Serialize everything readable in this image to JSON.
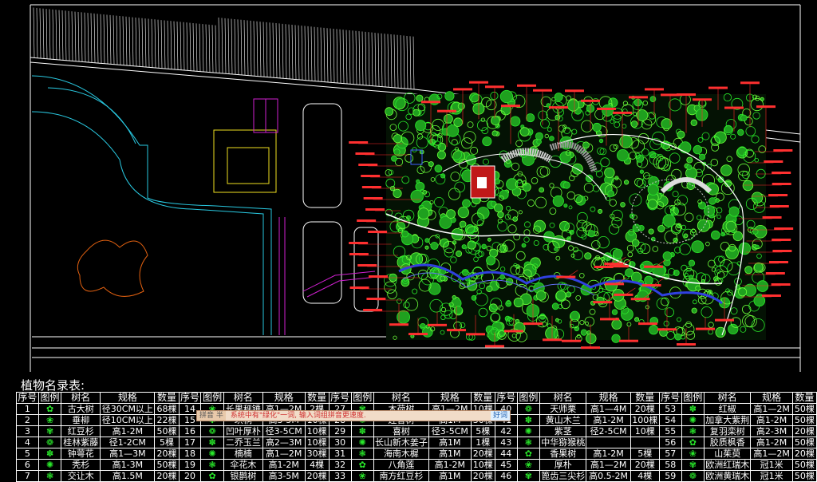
{
  "table_title": "植物名录表:",
  "table_headers": [
    "序号",
    "图例",
    "树名",
    "规格",
    "数量"
  ],
  "groups": [
    {
      "rows": [
        [
          "1",
          "古大树",
          "径30CM以上",
          "68棵"
        ],
        [
          "2",
          "垂柳",
          "径10CM以上",
          "22棵"
        ],
        [
          "3",
          "红豆杉",
          "高1-2M",
          "50棵"
        ],
        [
          "4",
          "桂林紫藤",
          "径1-2CM",
          "5棵"
        ],
        [
          "5",
          "钟萼花",
          "高1—3M",
          "20棵"
        ],
        [
          "6",
          "秃杉",
          "高1-3M",
          "50棵"
        ],
        [
          "7",
          "交让木",
          "高1.5M",
          "20棵"
        ]
      ]
    },
    {
      "rows": [
        [
          "14",
          "长果秤锤",
          "高1—2M",
          "2棵"
        ],
        [
          "15",
          "珙桐",
          "高3-5M",
          "10棵"
        ],
        [
          "16",
          "凹叶厚朴",
          "径3-5CM",
          "10棵"
        ],
        [
          "17",
          "二乔玉兰",
          "高2—3M",
          "10棵"
        ],
        [
          "18",
          "楠楠",
          "高1—2M",
          "30棵"
        ],
        [
          "19",
          "伞花木",
          "高1-2M",
          "4棵"
        ],
        [
          "20",
          "银鹊树",
          "高3-5M",
          "20棵"
        ]
      ]
    },
    {
      "rows": [
        [
          "27",
          "木荷树",
          "高1—2M",
          "10棵"
        ],
        [
          "28",
          "连香树",
          "高1M",
          "30棵"
        ],
        [
          "29",
          "喜树",
          "径3-5CM",
          "5棵"
        ],
        [
          "30",
          "长山新木姜子",
          "高1M",
          "1棵"
        ],
        [
          "31",
          "海南木樨",
          "高1M",
          "20棵"
        ],
        [
          "32",
          "八角莲",
          "高1-2M",
          "10棵"
        ],
        [
          "33",
          "南方红豆杉",
          "高1M",
          "20棵"
        ]
      ]
    },
    {
      "rows": [
        [
          "40",
          "天师栗",
          "高1—4M",
          "20棵"
        ],
        [
          "41",
          "黄山木兰",
          "高1-2M",
          "100棵"
        ],
        [
          "42",
          "紫茎",
          "径2-5CM",
          "10棵"
        ],
        [
          "43",
          "中华猕猴桃",
          "",
          ""
        ],
        [
          "44",
          "香果树",
          "高1-2M",
          "5棵"
        ],
        [
          "45",
          "厚朴",
          "高1—2M",
          "20棵"
        ],
        [
          "46",
          "篦齿三尖杉",
          "高0.5-2M",
          "4棵"
        ]
      ]
    },
    {
      "rows": [
        [
          "53",
          "红椒",
          "高1—2M",
          "50棵"
        ],
        [
          "54",
          "加拿大紫荆",
          "高1-2M",
          "50棵"
        ],
        [
          "55",
          "复羽栾树",
          "高2-3M",
          "20棵"
        ],
        [
          "56",
          "胶质枫香",
          "高1-2M",
          "50棵"
        ],
        [
          "57",
          "山茱萸",
          "高1—2M",
          "20棵"
        ],
        [
          "58",
          "欧洲红瑞木",
          "冠1米",
          "50棵"
        ],
        [
          "59",
          "欧洲黄瑞木",
          "冠1米",
          "50棵"
        ]
      ]
    }
  ],
  "overlay": {
    "ime_mode": "拼音 半",
    "hint": "系统中有\"绿化\"一词, 输入词组拼音更速度.",
    "button": "好词"
  },
  "colors": {
    "background": "#000000",
    "plant_symbol": "#29e82a",
    "label_leader": "#ff2a2a",
    "road_line": "#ffffff",
    "boundary": "#29c8e0",
    "building": "#f0e020",
    "wall": "#d020d0"
  }
}
